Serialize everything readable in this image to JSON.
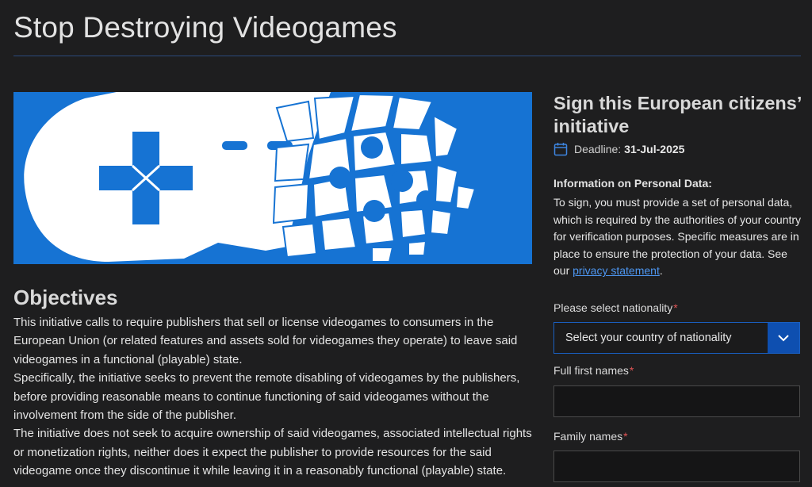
{
  "page_title": "Stop Destroying Videogames",
  "objectives": {
    "heading": "Objectives",
    "paragraphs": [
      "This initiative calls to require publishers that sell or license videogames to consumers in the European Union (or related features and assets sold for videogames they operate) to leave said videogames in a functional (playable) state.",
      "Specifically, the initiative seeks to prevent the remote disabling of videogames by the publishers, before providing reasonable means to continue functioning of said videogames without the involvement from the side of the publisher.",
      "The initiative does not seek to acquire ownership of said videogames, associated intellectual rights or monetization rights, neither does it expect the publisher to provide resources for the said videogame once they discontinue it while leaving it in a reasonably functional (playable) state."
    ]
  },
  "sign": {
    "title": "Sign this European citizens’ initiative",
    "deadline_label": "Deadline:",
    "deadline_value": "31-Jul-2025",
    "info_title": "Information on Personal Data:",
    "info_text": "To sign, you must provide a set of personal data, which is required by the authorities of your country for verification purposes. Specific measures are in place to ensure the protection of your data. See our ",
    "privacy_link": "privacy statement",
    "info_end": "."
  },
  "form": {
    "nationality_label": "Please select nationality",
    "nationality_placeholder": "Select your country of nationality",
    "first_names_label": "Full first names",
    "family_names_label": "Family names",
    "first_names_value": "",
    "family_names_value": "",
    "required_mark": "*"
  },
  "colors": {
    "background": "#1e1e1f",
    "hero_blue": "#1673d3",
    "accent_blue": "#0e4fb0",
    "link_blue": "#4d96f0",
    "required_red": "#e05555"
  },
  "icons": {
    "deadline": "calendar-icon",
    "select_arrow": "chevron-down-icon"
  }
}
